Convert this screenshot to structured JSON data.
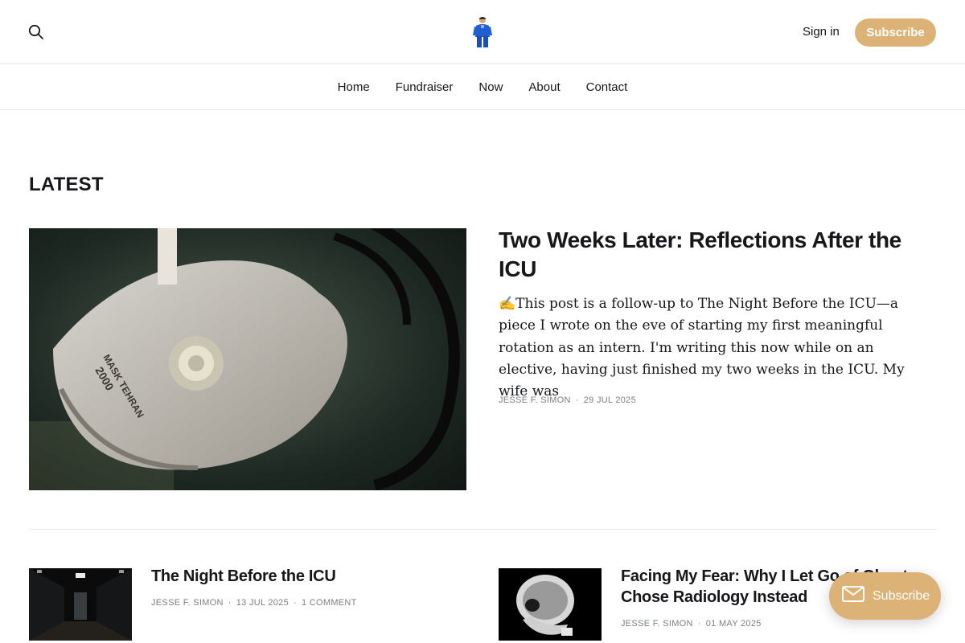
{
  "header": {
    "sign_in": "Sign in",
    "subscribe": "Subscribe"
  },
  "nav": {
    "items": [
      "Home",
      "Fundraiser",
      "Now",
      "About",
      "Contact"
    ]
  },
  "latest": {
    "section_title": "LATEST",
    "featured": {
      "title": "Two Weeks Later: Reflections After the ICU",
      "excerpt": "✍️This post is a follow-up to The Night Before the ICU—a piece I wrote on the eve of starting my first meaningful rotation as an intern. I'm writing this now while on an elective, having just finished my two weeks in the ICU. My wife was",
      "author": "JESSE F. SIMON",
      "date": "29 JUL 2025"
    },
    "posts": [
      {
        "title": "The Night Before the ICU",
        "author": "JESSE F. SIMON",
        "date": "13 JUL 2025",
        "comments": "1 COMMENT"
      },
      {
        "title": "Facing My Fear: Why I Let Go of Gho... Chose Radiology Instead",
        "title_line1": "Facing My Fear: Why I Let Go of Ghost",
        "title_line2": "Chose Radiology Instead",
        "author": "JESSE F. SIMON",
        "date": "01 MAY 2025"
      }
    ]
  },
  "portal": {
    "label": "Subscribe"
  },
  "colors": {
    "accent": "#dcb276",
    "text": "#15171a",
    "meta": "#7a7f85",
    "divider": "#e6e6e6"
  }
}
